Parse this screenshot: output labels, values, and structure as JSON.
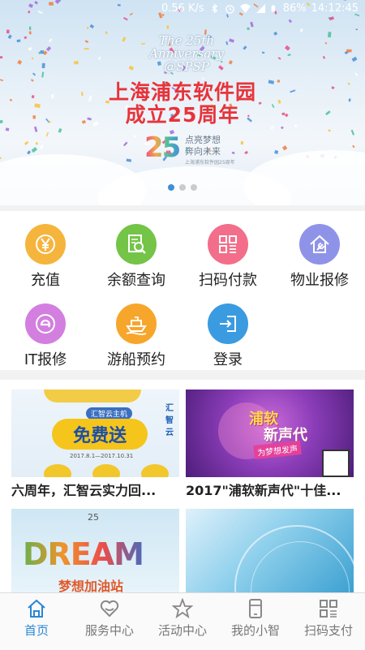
{
  "status_bar": {
    "speed": "0.56 K/s",
    "battery": "86%",
    "time": "14:12:45"
  },
  "banner": {
    "anniversary_line1": "The 25th",
    "anniversary_line2": "Anniversary",
    "anniversary_line3": "@SPSP",
    "title_line1": "上海浦东软件园",
    "title_line2": "成立25周年",
    "logo_number": "25",
    "slogan_line1": "点亮梦想",
    "slogan_line2": "奔向未来",
    "slogan_small": "上海浦东软件园25周年",
    "dots": 3,
    "active_dot": 0
  },
  "functions": [
    {
      "label": "充值",
      "icon": "yen-icon",
      "color": "#f5b43c"
    },
    {
      "label": "余额查询",
      "icon": "document-search-icon",
      "color": "#74c447"
    },
    {
      "label": "扫码付款",
      "icon": "qr-code-icon",
      "color": "#f36e8a"
    },
    {
      "label": "物业报修",
      "icon": "house-wrench-icon",
      "color": "#8f93e8"
    },
    {
      "label": "IT报修",
      "icon": "it-e-icon",
      "color": "#d37fe0"
    },
    {
      "label": "游船预约",
      "icon": "ship-icon",
      "color": "#f7a62c"
    },
    {
      "label": "登录",
      "icon": "login-icon",
      "color": "#3a9be0"
    }
  ],
  "news": [
    {
      "title": "六周年，汇智云实力回...",
      "image_text_1": "免费送",
      "image_text_2": "汇智云主机",
      "image_text_3": "汇智云",
      "image_text_4": "2017.8.1—2017.10.31"
    },
    {
      "title": "2017\"浦软新声代\"十佳...",
      "image_text_1": "浦软",
      "image_text_2": "新声代",
      "image_text_3": "为梦想发声"
    },
    {
      "title": "",
      "image_text_1": "25",
      "image_text_2": "DREAM",
      "image_text_3": "梦想加油站"
    },
    {
      "title": ""
    }
  ],
  "tabs": [
    {
      "label": "首页",
      "icon": "home-icon",
      "active": true
    },
    {
      "label": "服务中心",
      "icon": "heart-icon",
      "active": false
    },
    {
      "label": "活动中心",
      "icon": "star-icon",
      "active": false
    },
    {
      "label": "我的小智",
      "icon": "phone-card-icon",
      "active": false
    },
    {
      "label": "扫码支付",
      "icon": "qr-scan-icon",
      "active": false
    }
  ],
  "colors": {
    "accent": "#2a86d6",
    "banner_title": "#e8333b"
  }
}
